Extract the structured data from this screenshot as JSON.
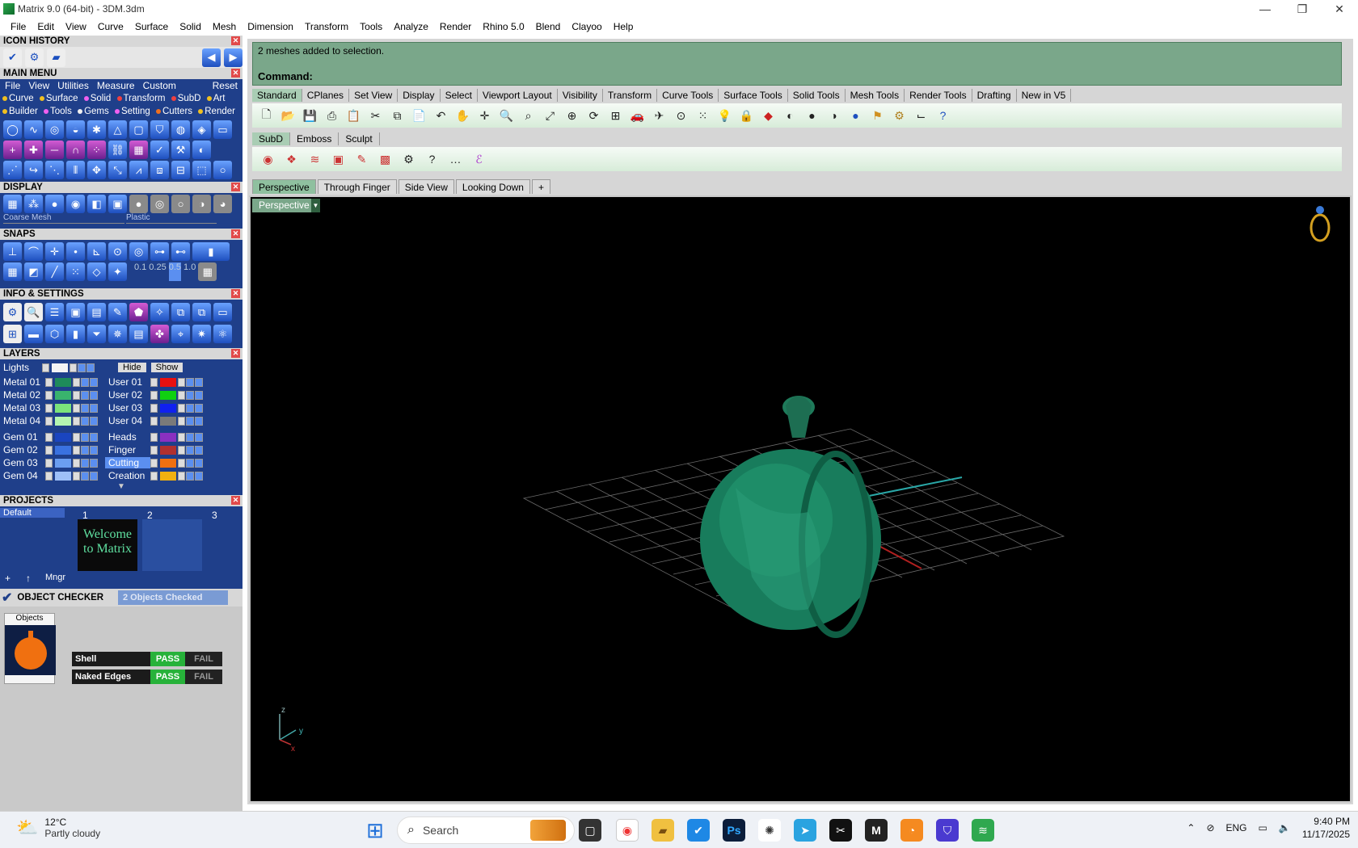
{
  "window": {
    "title": "Matrix 9.0 (64-bit) - 3DM.3dm",
    "min": "—",
    "max": "❐",
    "close": "✕"
  },
  "menubar": [
    "File",
    "Edit",
    "View",
    "Curve",
    "Surface",
    "Solid",
    "Mesh",
    "Dimension",
    "Transform",
    "Tools",
    "Analyze",
    "Render",
    "Rhino 5.0",
    "Blend",
    "Clayoo",
    "Help"
  ],
  "left": {
    "icon_history": {
      "title": "ICON HISTORY"
    },
    "main_menu": {
      "title": "MAIN MENU",
      "tabs": [
        "File",
        "View",
        "Utilities",
        "Measure",
        "Custom"
      ],
      "reset": "Reset",
      "row1": [
        "Curve",
        "Surface",
        "Solid",
        "Transform",
        "SubD",
        "Art"
      ],
      "row2": [
        "Builder",
        "Tools",
        "Gems",
        "Setting",
        "Cutters",
        "Render"
      ]
    },
    "display": {
      "title": "DISPLAY",
      "mesh_select": "Coarse Mesh",
      "material_select": "Plastic"
    },
    "snaps": {
      "title": "SNAPS",
      "values": [
        "0.1",
        "0.25",
        "0.5",
        "1.0"
      ]
    },
    "info": {
      "title": "INFO & SETTINGS"
    },
    "layers": {
      "title": "LAYERS",
      "lights": "Lights",
      "hide": "Hide",
      "show": "Show",
      "left": [
        {
          "name": "Metal 01",
          "color": "#1e8a5a"
        },
        {
          "name": "Metal 02",
          "color": "#39b36d"
        },
        {
          "name": "Metal 03",
          "color": "#7be37b"
        },
        {
          "name": "Metal 04",
          "color": "#b5f5b0"
        },
        {
          "name": "Gem 01",
          "color": "#1a45c0"
        },
        {
          "name": "Gem 02",
          "color": "#3a72e0"
        },
        {
          "name": "Gem 03",
          "color": "#6b9ef0"
        },
        {
          "name": "Gem 04",
          "color": "#9ec0f8"
        }
      ],
      "right": [
        {
          "name": "User 01",
          "color": "#e81010"
        },
        {
          "name": "User 02",
          "color": "#10d010"
        },
        {
          "name": "User 03",
          "color": "#1020f0"
        },
        {
          "name": "User 04",
          "color": "#7a7a7a"
        },
        {
          "name": "Heads",
          "color": "#8a30c0"
        },
        {
          "name": "Finger",
          "color": "#b03030"
        },
        {
          "name": "Cutting",
          "color": "#f07010"
        },
        {
          "name": "Creation",
          "color": "#f0b010"
        }
      ]
    },
    "projects": {
      "title": "PROJECTS",
      "default": "Default",
      "slots": [
        "1",
        "2",
        "3"
      ],
      "welcome": "Welcome to Matrix",
      "mngr": "Mngr"
    },
    "object_checker": {
      "title": "OBJECT CHECKER",
      "status": "2 Objects Checked",
      "objects_label": "Objects",
      "checks": [
        {
          "name": "Shell",
          "pass": "PASS",
          "fail": "FAIL"
        },
        {
          "name": "Naked Edges",
          "pass": "PASS",
          "fail": "FAIL"
        }
      ]
    }
  },
  "command": {
    "message": "2 meshes added to selection.",
    "prompt": "Command:"
  },
  "toolbar_tabs": [
    "Standard",
    "CPlanes",
    "Set View",
    "Display",
    "Select",
    "Viewport Layout",
    "Visibility",
    "Transform",
    "Curve Tools",
    "Surface Tools",
    "Solid Tools",
    "Mesh Tools",
    "Render Tools",
    "Drafting",
    "New in V5"
  ],
  "subd_tabs": [
    "SubD",
    "Emboss",
    "Sculpt"
  ],
  "viewport_tabs": [
    "Perspective",
    "Through Finger",
    "Side View",
    "Looking Down",
    "+"
  ],
  "viewport": {
    "label": "Perspective",
    "axis_z": "z",
    "axis_y": "y",
    "axis_x": "x"
  },
  "taskbar": {
    "weather_temp": "12°C",
    "weather_desc": "Partly cloudy",
    "search": "Search",
    "lang": "ENG",
    "time": "9:40 PM",
    "date": "11/17/2025"
  }
}
